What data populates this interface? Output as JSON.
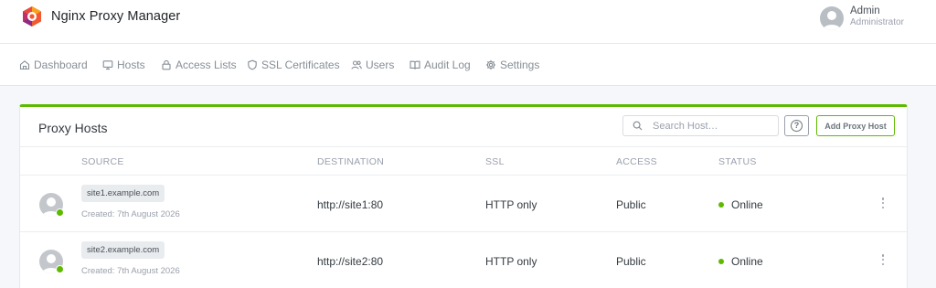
{
  "app": {
    "title": "Nginx Proxy Manager"
  },
  "user": {
    "name": "Admin",
    "role": "Administrator"
  },
  "nav": [
    {
      "label": "Dashboard",
      "icon": "home-icon"
    },
    {
      "label": "Hosts",
      "icon": "monitor-icon"
    },
    {
      "label": "Access Lists",
      "icon": "lock-icon"
    },
    {
      "label": "SSL Certificates",
      "icon": "shield-icon"
    },
    {
      "label": "Users",
      "icon": "users-icon"
    },
    {
      "label": "Audit Log",
      "icon": "book-icon"
    },
    {
      "label": "Settings",
      "icon": "gear-icon"
    }
  ],
  "card": {
    "title": "Proxy Hosts",
    "search_placeholder": "Search Host…",
    "help_label": "?",
    "add_label": "Add Proxy Host",
    "accent_color": "#5eba00"
  },
  "table": {
    "headers": [
      "SOURCE",
      "DESTINATION",
      "SSL",
      "ACCESS",
      "STATUS"
    ],
    "rows": [
      {
        "host": "site1.example.com",
        "created": "Created: 7th August 2026",
        "destination": "http://site1:80",
        "ssl": "HTTP only",
        "access": "Public",
        "status": "Online"
      },
      {
        "host": "site2.example.com",
        "created": "Created: 7th August 2026",
        "destination": "http://site2:80",
        "ssl": "HTTP only",
        "access": "Public",
        "status": "Online"
      }
    ]
  }
}
